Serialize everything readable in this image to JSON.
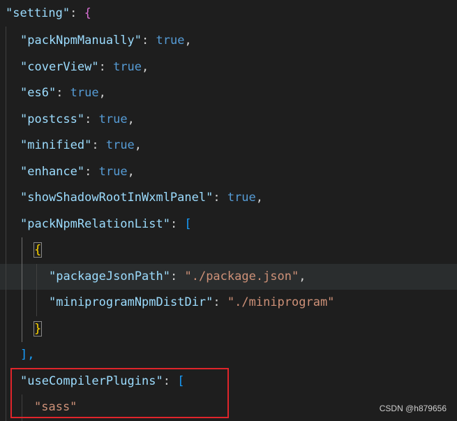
{
  "code": {
    "setting_key": "\"setting\"",
    "packNpmManually_key": "\"packNpmManually\"",
    "coverView_key": "\"coverView\"",
    "es6_key": "\"es6\"",
    "postcss_key": "\"postcss\"",
    "minified_key": "\"minified\"",
    "enhance_key": "\"enhance\"",
    "showShadowRootInWxmlPanel_key": "\"showShadowRootInWxmlPanel\"",
    "packNpmRelationList_key": "\"packNpmRelationList\"",
    "packageJsonPath_key": "\"packageJsonPath\"",
    "packageJsonPath_value": "\"./package.json\"",
    "miniprogramNpmDistDir_key": "\"miniprogramNpmDistDir\"",
    "miniprogramNpmDistDir_value": "\"./miniprogram\"",
    "useCompilerPlugins_key": "\"useCompilerPlugins\"",
    "sass_value": "\"sass\"",
    "true_literal": "true",
    "colon": ": ",
    "comma": ",",
    "open_brace": "{",
    "close_brace": "}",
    "open_bracket": "[",
    "close_bracket_comma": "],"
  },
  "watermark": "CSDN @h879656",
  "colors": {
    "background": "#1e1e1e",
    "key": "#9cdcfe",
    "string": "#ce9178",
    "boolean": "#569cd6",
    "highlight_box": "#e0252b"
  }
}
